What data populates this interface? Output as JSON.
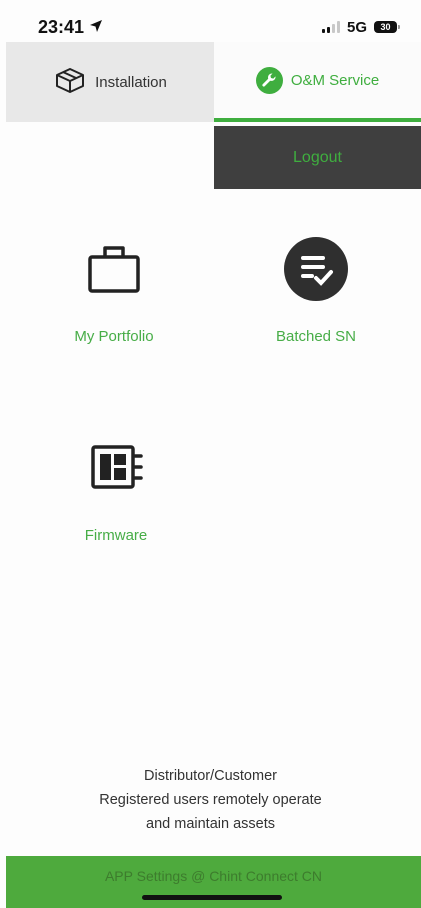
{
  "status_bar": {
    "time": "23:41",
    "network": "5G",
    "battery": "30"
  },
  "tabs": {
    "installation": {
      "label": "Installation",
      "icon": "box-icon"
    },
    "om_service": {
      "label": "O&M Service",
      "icon": "wrench-icon"
    }
  },
  "logout": {
    "label": "Logout"
  },
  "tiles": {
    "portfolio": {
      "label": "My Portfolio",
      "icon": "briefcase-icon"
    },
    "batched": {
      "label": "Batched SN",
      "icon": "checklist-icon"
    },
    "firmware": {
      "label": "Firmware",
      "icon": "chip-icon"
    }
  },
  "info": {
    "line1": "Distributor/Customer",
    "line2": "Registered users remotely operate",
    "line3": "and maintain assets"
  },
  "footer": {
    "label": "APP Settings @ Chint Connect CN"
  },
  "colors": {
    "accent": "#3fae3f",
    "dark": "#3f3f3f",
    "footer_bg": "#4eaa3d"
  }
}
